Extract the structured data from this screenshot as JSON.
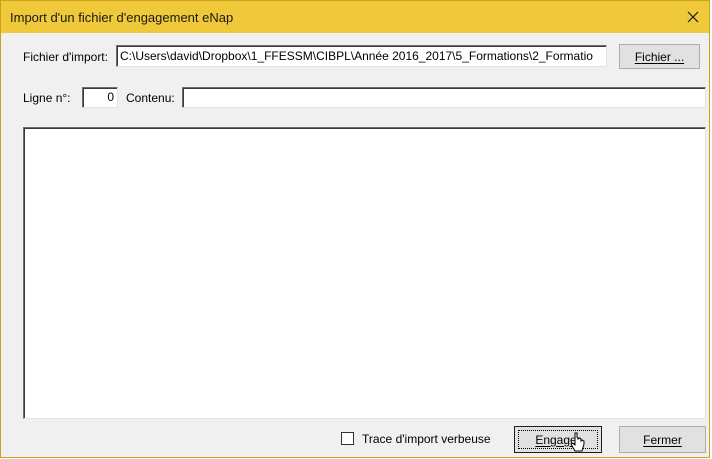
{
  "window": {
    "title": "Import d'un fichier d'engagement eNap"
  },
  "import_row": {
    "file_label": "Fichier d'import:",
    "file_path": "C:\\Users\\david\\Dropbox\\1_FFESSM\\CIBPL\\Année 2016_2017\\5_Formations\\2_Formatio",
    "browse_button_label": "Fichier ..."
  },
  "line_row": {
    "line_label": "Ligne n°:",
    "line_value": "0",
    "content_label": "Contenu:",
    "content_value": ""
  },
  "log_area": {
    "content": ""
  },
  "footer": {
    "verbose_label": "Trace d'import verbeuse",
    "verbose_checked": false,
    "engage_button_label": "Engager",
    "close_button_label": "Fermer"
  },
  "icons": {
    "close": "close-icon",
    "cursor": "mouse-pointer-icon",
    "checkbox": "checkbox-icon"
  },
  "colors": {
    "titlebar": "#f0c93a",
    "window_border": "#c9a11c",
    "window_bg": "#f0f0f0"
  }
}
